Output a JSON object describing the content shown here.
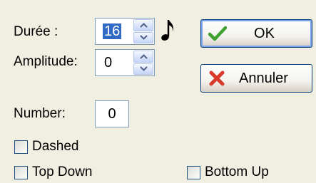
{
  "duree": {
    "label": "Durée :",
    "value": "16"
  },
  "amplitude": {
    "label": "Amplitude:",
    "value": "0"
  },
  "number": {
    "label": "Number:",
    "value": "0"
  },
  "buttons": {
    "ok": "OK",
    "cancel": "Annuler"
  },
  "checkboxes": {
    "dashed": {
      "label": "Dashed",
      "checked": false
    },
    "top_down": {
      "label": "Top Down",
      "checked": false
    },
    "bottom_up": {
      "label": "Bottom Up",
      "checked": false
    }
  },
  "icons": {
    "duree_note": "eighth-note-icon",
    "ok": "green-check-icon",
    "cancel": "red-x-icon",
    "spin_up": "chevron-up-icon",
    "spin_down": "chevron-down-icon"
  },
  "colors": {
    "background": "#f1efe2",
    "selection": "#316ac5",
    "check": "#3fa12f",
    "cancel_x": "#d83a2c",
    "control_border": "#7f9db9"
  }
}
